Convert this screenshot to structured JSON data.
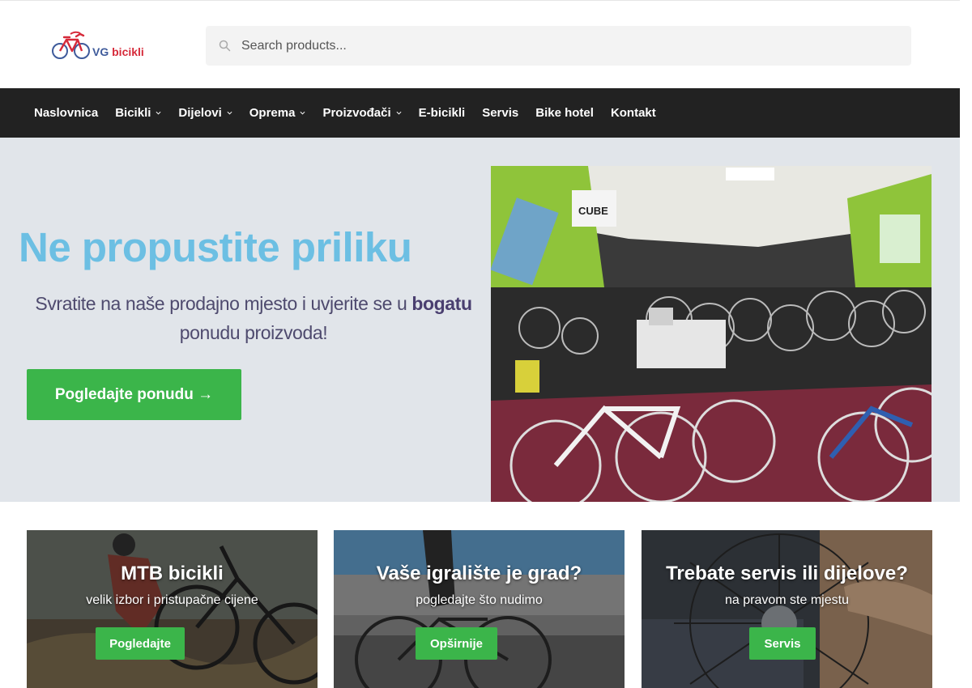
{
  "header": {
    "logo": {
      "vg": "VG",
      "bicikli": "bicikli"
    },
    "search": {
      "placeholder": "Search products..."
    }
  },
  "nav": {
    "items": [
      {
        "label": "Naslovnica",
        "dropdown": false
      },
      {
        "label": "Bicikli",
        "dropdown": true
      },
      {
        "label": "Dijelovi",
        "dropdown": true
      },
      {
        "label": "Oprema",
        "dropdown": true
      },
      {
        "label": "Proizvođači",
        "dropdown": true
      },
      {
        "label": "E-bicikli",
        "dropdown": false
      },
      {
        "label": "Servis",
        "dropdown": false
      },
      {
        "label": "Bike hotel",
        "dropdown": false
      },
      {
        "label": "Kontakt",
        "dropdown": false
      }
    ]
  },
  "hero": {
    "title": "Ne propustite priliku",
    "text_before": "Svratite na naše prodajno mjesto i uvjerite se u ",
    "text_bold": "bogatu",
    "text_after": " ponudu proizvoda!",
    "button": "Pogledajte ponudu →",
    "image": "bike-shop-interior-photo"
  },
  "cards": [
    {
      "title": "MTB bicikli",
      "subtitle": "velik izbor i pristupačne cijene",
      "button": "Pogledajte",
      "image": "mountain-biker-photo"
    },
    {
      "title": "Vaše igralište je grad?",
      "subtitle": "pogledajte što nudimo",
      "button": "Opširnije",
      "image": "city-cyclist-photo"
    },
    {
      "title": "Trebate servis ili dijelove?",
      "subtitle": "na pravom ste mjestu",
      "button": "Servis",
      "image": "bike-wheel-service-photo"
    }
  ],
  "colors": {
    "accent_green": "#3bb54a",
    "hero_title": "#6cbfe3",
    "nav_bg": "#222222",
    "hero_bg": "#e1e5ea"
  }
}
